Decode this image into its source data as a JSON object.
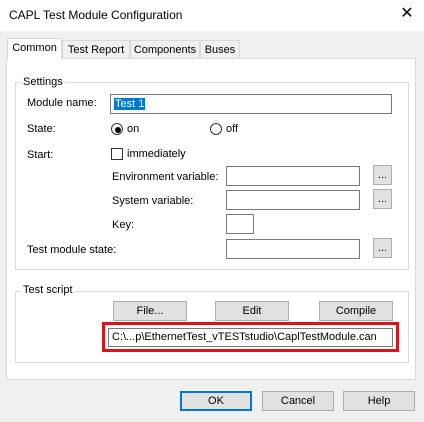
{
  "window": {
    "title": "CAPL Test Module Configuration",
    "close_glyph": "✕"
  },
  "tabs": [
    {
      "label": "Common",
      "active": true
    },
    {
      "label": "Test Report",
      "active": false
    },
    {
      "label": "Components",
      "active": false
    },
    {
      "label": "Buses",
      "active": false
    }
  ],
  "settings": {
    "group_label": "Settings",
    "module_name_label": "Module name:",
    "module_name_value": "Test 1",
    "state_label": "State:",
    "state_on": "on",
    "state_off": "off",
    "start_label": "Start:",
    "immediately_label": "immediately",
    "env_var_label": "Environment variable:",
    "sys_var_label": "System variable:",
    "key_label": "Key:",
    "test_module_state_label": "Test module state:",
    "browse_label": "..."
  },
  "test_script": {
    "group_label": "Test script",
    "file_button": "File...",
    "edit_button": "Edit",
    "compile_button": "Compile",
    "path_value": "C:\\...p\\EthernetTest_vTESTstudio\\CaplTestModule.can"
  },
  "footer": {
    "ok": "OK",
    "cancel": "Cancel",
    "help": "Help"
  },
  "colors": {
    "highlight": "#d9141d",
    "selection": "#0078d7"
  }
}
